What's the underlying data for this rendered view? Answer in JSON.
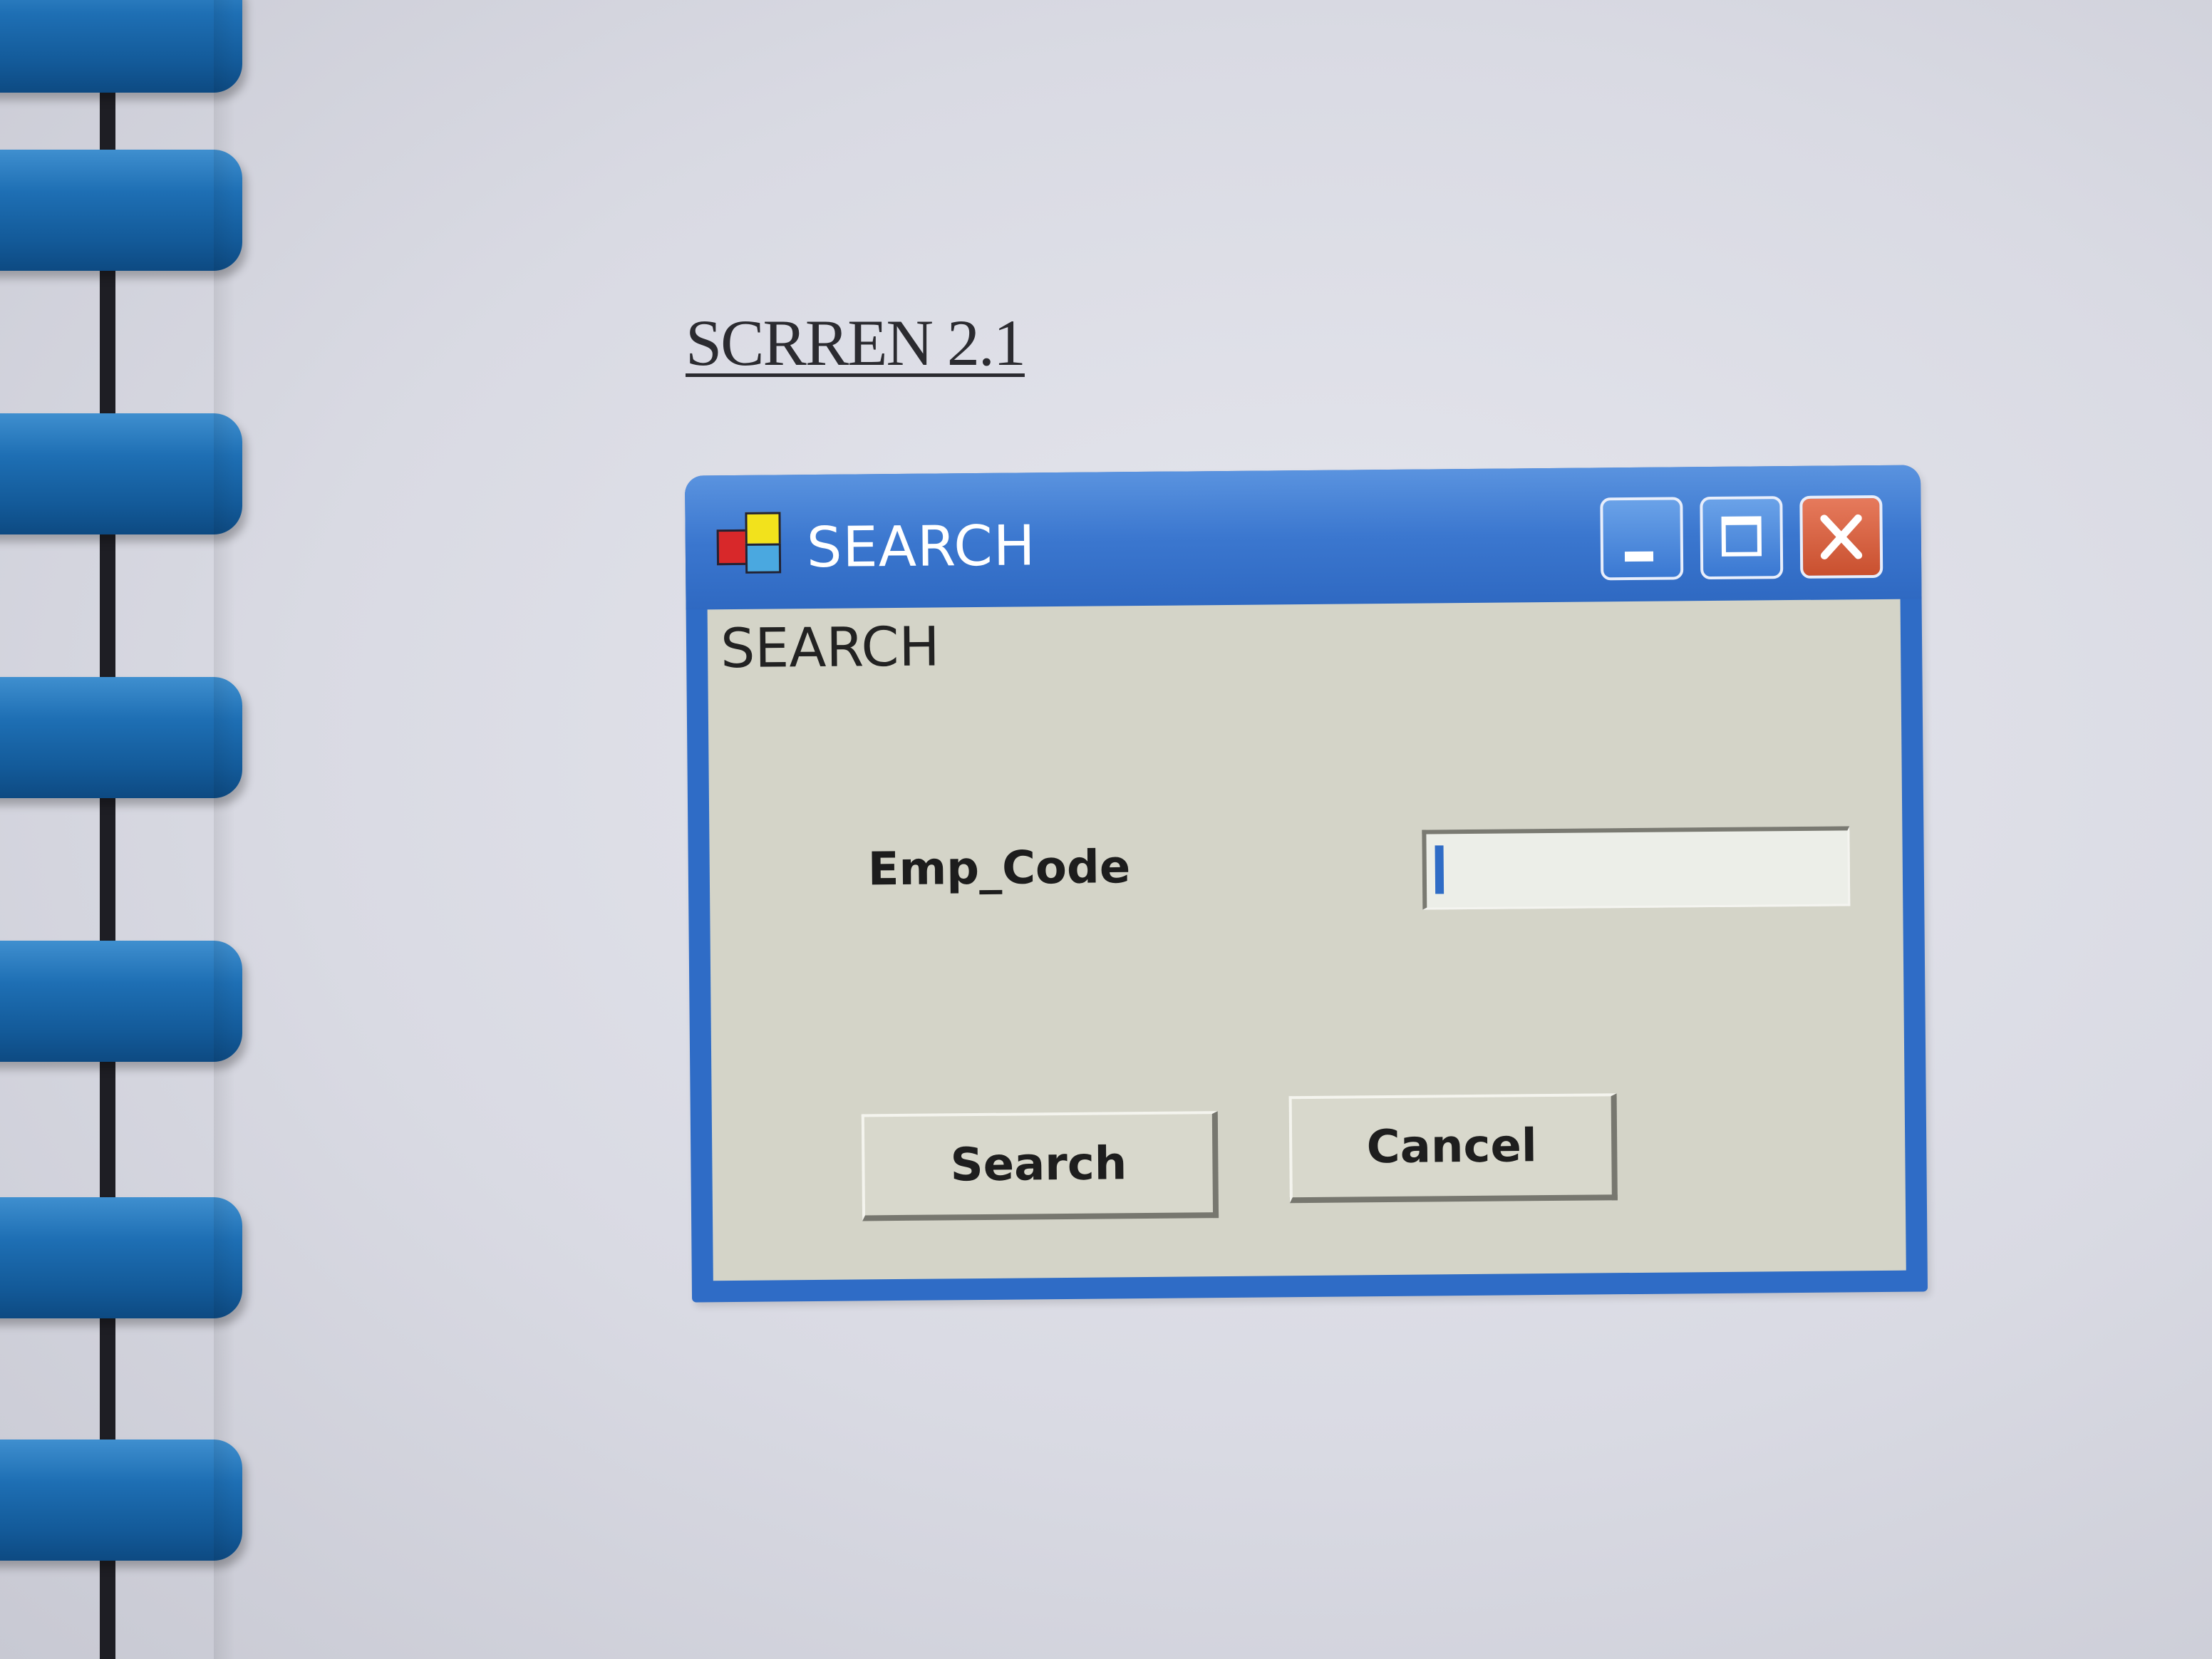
{
  "document": {
    "heading": "SCRREN 2.1"
  },
  "dialog": {
    "title": "SEARCH",
    "form_caption": "SEARCH",
    "fields": {
      "emp_code_label": "Emp_Code",
      "emp_code_value": ""
    },
    "buttons": {
      "search": "Search",
      "cancel": "Cancel"
    },
    "titlebar_buttons": [
      "minimize-icon",
      "maximize-icon",
      "close-icon"
    ]
  },
  "colors": {
    "titlebar_blue": "#2f6cc6",
    "client_gray": "#d4d4c8",
    "close_orange": "#c9502f",
    "binding_blue": "#1e6fb4"
  }
}
